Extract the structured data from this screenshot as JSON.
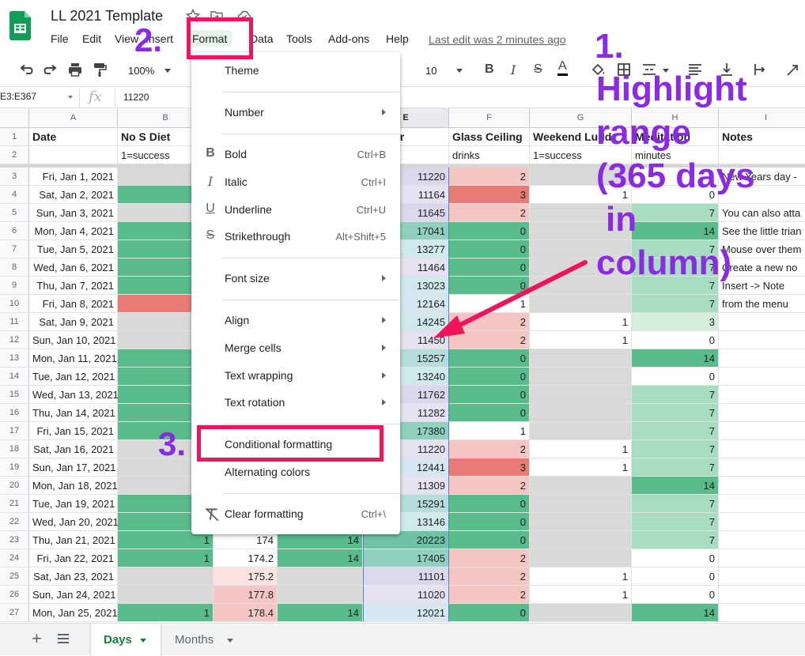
{
  "doc": {
    "title": "LL 2021 Template",
    "last_edit": "Last edit was 2 minutes ago"
  },
  "menubar": [
    "File",
    "Edit",
    "View",
    "Insert",
    "Format",
    "Data",
    "Tools",
    "Add-ons",
    "Help"
  ],
  "toolbar": {
    "zoom": "100%",
    "font_size": "10"
  },
  "formula_bar": {
    "name_box": "E3:E367",
    "fx": "fx",
    "value": "11220"
  },
  "columns": [
    "A",
    "B",
    "C",
    "D",
    "E",
    "F",
    "G",
    "H",
    "I"
  ],
  "selected_column": "E",
  "header_row": {
    "num": "1",
    "cells": {
      "A": "Date",
      "B": "No S Diet",
      "E": "Ranger",
      "F": "Glass Ceiling",
      "G": "Weekend Ludd",
      "H": "Meditation",
      "I": "Notes"
    }
  },
  "subheader_row": {
    "num": "2",
    "cells": {
      "B": "1=success",
      "F": "drinks",
      "G": "1=success",
      "H": "minutes"
    }
  },
  "rows": [
    {
      "num": "3",
      "date": "Fri, Jan 1, 2021",
      "e": "11220",
      "f": "2",
      "g": "",
      "h": "",
      "i": "New Years day -"
    },
    {
      "num": "4",
      "date": "Sat, Jan 2, 2021",
      "e": "11164",
      "f": "3",
      "g": "1",
      "h": "0",
      "i": ""
    },
    {
      "num": "5",
      "date": "Sun, Jan 3, 2021",
      "e": "11645",
      "f": "2",
      "g": "",
      "h": "7",
      "i": "You can also atta"
    },
    {
      "num": "6",
      "date": "Mon, Jan 4, 2021",
      "e": "17041",
      "f": "0",
      "g": "",
      "h": "14",
      "i": "See the little trian"
    },
    {
      "num": "7",
      "date": "Tue, Jan 5, 2021",
      "e": "13277",
      "f": "0",
      "g": "",
      "h": "7",
      "i": "Mouse over them"
    },
    {
      "num": "8",
      "date": "Wed, Jan 6, 2021",
      "e": "11464",
      "f": "0",
      "g": "",
      "h": "7",
      "i": "Create a new no"
    },
    {
      "num": "9",
      "date": "Thu, Jan 7, 2021",
      "e": "13023",
      "f": "0",
      "g": "",
      "h": "7",
      "i": "Insert -> Note"
    },
    {
      "num": "10",
      "date": "Fri, Jan 8, 2021",
      "e": "12164",
      "f": "1",
      "g": "",
      "h": "7",
      "i": "from the menu"
    },
    {
      "num": "11",
      "date": "Sat, Jan 9, 2021",
      "e": "14245",
      "f": "2",
      "g": "1",
      "h": "3",
      "i": ""
    },
    {
      "num": "12",
      "date": "Sun, Jan 10, 2021",
      "e": "11450",
      "f": "2",
      "g": "1",
      "h": "0",
      "i": ""
    },
    {
      "num": "13",
      "date": "Mon, Jan 11, 2021",
      "e": "15257",
      "f": "0",
      "g": "",
      "h": "14",
      "i": ""
    },
    {
      "num": "14",
      "date": "Tue, Jan 12, 2021",
      "e": "13240",
      "f": "0",
      "g": "",
      "h": "0",
      "i": ""
    },
    {
      "num": "15",
      "date": "Wed, Jan 13, 2021",
      "e": "11762",
      "f": "0",
      "g": "",
      "h": "7",
      "i": ""
    },
    {
      "num": "16",
      "date": "Thu, Jan 14, 2021",
      "e": "11282",
      "f": "0",
      "g": "",
      "h": "7",
      "i": ""
    },
    {
      "num": "17",
      "date": "Fri, Jan 15, 2021",
      "e": "17380",
      "f": "1",
      "g": "",
      "h": "7",
      "i": ""
    },
    {
      "num": "18",
      "date": "Sat, Jan 16, 2021",
      "e": "11220",
      "f": "2",
      "g": "1",
      "h": "7",
      "i": ""
    },
    {
      "num": "19",
      "date": "Sun, Jan 17, 2021",
      "e": "12441",
      "f": "3",
      "g": "1",
      "h": "7",
      "i": ""
    },
    {
      "num": "20",
      "date": "Mon, Jan 18, 2021",
      "e": "11309",
      "f": "2",
      "g": "",
      "h": "14",
      "i": ""
    },
    {
      "num": "21",
      "date": "Tue, Jan 19, 2021",
      "e": "15291",
      "f": "0",
      "g": "",
      "h": "7",
      "i": ""
    },
    {
      "num": "22",
      "date": "Wed, Jan 20, 2021",
      "e": "13146",
      "f": "0",
      "g": "",
      "h": "7",
      "i": ""
    },
    {
      "num": "23",
      "date": "Thu, Jan 21, 2021",
      "b": "1",
      "c": "174",
      "d": "14",
      "e": "20223",
      "f": "0",
      "g": "",
      "h": "7",
      "i": ""
    },
    {
      "num": "24",
      "date": "Fri, Jan 22, 2021",
      "b": "1",
      "c": "174.2",
      "d": "14",
      "e": "17405",
      "f": "2",
      "g": "",
      "h": "0",
      "i": ""
    },
    {
      "num": "25",
      "date": "Sat, Jan 23, 2021",
      "c": "175.2",
      "e": "11101",
      "f": "2",
      "g": "1",
      "h": "0",
      "i": ""
    },
    {
      "num": "26",
      "date": "Sun, Jan 24, 2021",
      "c": "177.8",
      "e": "11020",
      "f": "2",
      "g": "1",
      "h": "0",
      "i": ""
    },
    {
      "num": "27",
      "date": "Mon, Jan 25, 2021",
      "b": "1",
      "c": "178.4",
      "d": "14",
      "e": "12021",
      "f": "0",
      "g": "",
      "h": "14",
      "i": ""
    }
  ],
  "format_menu": {
    "items": [
      {
        "label": "Theme"
      },
      {
        "label": "Number",
        "submenu": true
      },
      {
        "label": "Bold",
        "shortcut": "Ctrl+B",
        "icon": "B"
      },
      {
        "label": "Italic",
        "shortcut": "Ctrl+I",
        "icon": "I"
      },
      {
        "label": "Underline",
        "shortcut": "Ctrl+U",
        "icon": "U"
      },
      {
        "label": "Strikethrough",
        "shortcut": "Alt+Shift+5",
        "icon": "S"
      },
      {
        "label": "Font size",
        "submenu": true
      },
      {
        "label": "Align",
        "submenu": true
      },
      {
        "label": "Merge cells",
        "submenu": true
      },
      {
        "label": "Text wrapping",
        "submenu": true
      },
      {
        "label": "Text rotation",
        "submenu": true
      },
      {
        "label": "Conditional formatting"
      },
      {
        "label": "Alternating colors"
      },
      {
        "label": "Clear formatting",
        "shortcut": "Ctrl+\\"
      }
    ]
  },
  "annotations": {
    "step1_num": "1.",
    "step1_lines": [
      "Highlight",
      "range",
      "(365 days",
      "in",
      "column)"
    ],
    "step2": "2.",
    "step3": "3."
  },
  "sheet_tabs": {
    "active": "Days",
    "other": "Months"
  },
  "colors": {
    "green": "#57bb8a",
    "light_green": "#a8dcc1",
    "pale_green": "#d4eede",
    "gray": "#d9d9d9",
    "red": "#e67c73",
    "light_red": "#f5c6c3",
    "pale_red": "#fbe3e2",
    "annotation_purple": "#8a2be2",
    "annotation_red": "#f0145a",
    "sheets_green": "#188038"
  }
}
